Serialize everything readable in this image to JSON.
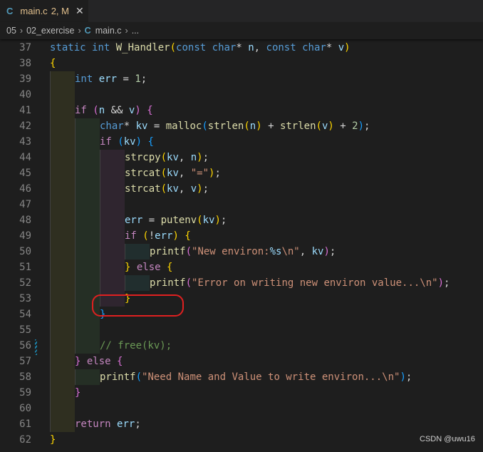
{
  "tab": {
    "icon": "C",
    "name": "main.c",
    "badge": "2, M",
    "close": "✕"
  },
  "breadcrumb": {
    "parts": [
      "05",
      "02_exercise",
      "main.c",
      "..."
    ],
    "sep": "›",
    "icon": "C"
  },
  "watermark": "CSDN @uwu16",
  "lines": [
    {
      "n": "37",
      "indent": 0,
      "tokens": [
        [
          "kw",
          "static"
        ],
        [
          "pl",
          " "
        ],
        [
          "kw",
          "int"
        ],
        [
          "pl",
          " "
        ],
        [
          "fn",
          "W_Handler"
        ],
        [
          "b1",
          "("
        ],
        [
          "kw",
          "const"
        ],
        [
          "pl",
          " "
        ],
        [
          "kw",
          "char"
        ],
        [
          "pl",
          "* "
        ],
        [
          "vr",
          "n"
        ],
        [
          "pl",
          ", "
        ],
        [
          "kw",
          "const"
        ],
        [
          "pl",
          " "
        ],
        [
          "kw",
          "char"
        ],
        [
          "pl",
          "* "
        ],
        [
          "vr",
          "v"
        ],
        [
          "b1",
          ")"
        ]
      ]
    },
    {
      "n": "38",
      "indent": 0,
      "tokens": [
        [
          "b1",
          "{"
        ]
      ]
    },
    {
      "n": "39",
      "indent": 1,
      "tokens": [
        [
          "kw",
          "int"
        ],
        [
          "pl",
          " "
        ],
        [
          "vr",
          "err"
        ],
        [
          "pl",
          " = "
        ],
        [
          "nu",
          "1"
        ],
        [
          "pl",
          ";"
        ]
      ]
    },
    {
      "n": "40",
      "indent": 0,
      "tokens": []
    },
    {
      "n": "41",
      "indent": 1,
      "tokens": [
        [
          "ct",
          "if"
        ],
        [
          "pl",
          " "
        ],
        [
          "b2",
          "("
        ],
        [
          "vr",
          "n"
        ],
        [
          "pl",
          " && "
        ],
        [
          "vr",
          "v"
        ],
        [
          "b2",
          ")"
        ],
        [
          "pl",
          " "
        ],
        [
          "b2",
          "{"
        ]
      ]
    },
    {
      "n": "42",
      "indent": 2,
      "tokens": [
        [
          "kw",
          "char"
        ],
        [
          "pl",
          "* "
        ],
        [
          "vr",
          "kv"
        ],
        [
          "pl",
          " = "
        ],
        [
          "fn",
          "malloc"
        ],
        [
          "b3",
          "("
        ],
        [
          "fn",
          "strlen"
        ],
        [
          "b1",
          "("
        ],
        [
          "vr",
          "n"
        ],
        [
          "b1",
          ")"
        ],
        [
          "pl",
          " + "
        ],
        [
          "fn",
          "strlen"
        ],
        [
          "b1",
          "("
        ],
        [
          "vr",
          "v"
        ],
        [
          "b1",
          ")"
        ],
        [
          "pl",
          " + "
        ],
        [
          "nu",
          "2"
        ],
        [
          "b3",
          ")"
        ],
        [
          "pl",
          ";"
        ]
      ]
    },
    {
      "n": "43",
      "indent": 2,
      "tokens": [
        [
          "ct",
          "if"
        ],
        [
          "pl",
          " "
        ],
        [
          "b3",
          "("
        ],
        [
          "vr",
          "kv"
        ],
        [
          "b3",
          ")"
        ],
        [
          "pl",
          " "
        ],
        [
          "b3",
          "{"
        ]
      ]
    },
    {
      "n": "44",
      "indent": 3,
      "tokens": [
        [
          "fn",
          "strcpy"
        ],
        [
          "b1",
          "("
        ],
        [
          "vr",
          "kv"
        ],
        [
          "pl",
          ", "
        ],
        [
          "vr",
          "n"
        ],
        [
          "b1",
          ")"
        ],
        [
          "pl",
          ";"
        ]
      ]
    },
    {
      "n": "45",
      "indent": 3,
      "tokens": [
        [
          "fn",
          "strcat"
        ],
        [
          "b1",
          "("
        ],
        [
          "vr",
          "kv"
        ],
        [
          "pl",
          ", "
        ],
        [
          "st",
          "\"=\""
        ],
        [
          "b1",
          ")"
        ],
        [
          "pl",
          ";"
        ]
      ]
    },
    {
      "n": "46",
      "indent": 3,
      "tokens": [
        [
          "fn",
          "strcat"
        ],
        [
          "b1",
          "("
        ],
        [
          "vr",
          "kv"
        ],
        [
          "pl",
          ", "
        ],
        [
          "vr",
          "v"
        ],
        [
          "b1",
          ")"
        ],
        [
          "pl",
          ";"
        ]
      ]
    },
    {
      "n": "47",
      "indent": 0,
      "tokens": []
    },
    {
      "n": "48",
      "indent": 3,
      "tokens": [
        [
          "vr",
          "err"
        ],
        [
          "pl",
          " = "
        ],
        [
          "fn",
          "putenv"
        ],
        [
          "b1",
          "("
        ],
        [
          "vr",
          "kv"
        ],
        [
          "b1",
          ")"
        ],
        [
          "pl",
          ";"
        ]
      ]
    },
    {
      "n": "49",
      "indent": 3,
      "tokens": [
        [
          "ct",
          "if"
        ],
        [
          "pl",
          " "
        ],
        [
          "b1",
          "("
        ],
        [
          "pl",
          "!"
        ],
        [
          "vr",
          "err"
        ],
        [
          "b1",
          ")"
        ],
        [
          "pl",
          " "
        ],
        [
          "b1",
          "{"
        ]
      ]
    },
    {
      "n": "50",
      "indent": 4,
      "tokens": [
        [
          "fn",
          "printf"
        ],
        [
          "b2",
          "("
        ],
        [
          "st",
          "\"New environ:"
        ],
        [
          "vr",
          "%s"
        ],
        [
          "st",
          "\\n\""
        ],
        [
          "pl",
          ", "
        ],
        [
          "vr",
          "kv"
        ],
        [
          "b2",
          ")"
        ],
        [
          "pl",
          ";"
        ]
      ]
    },
    {
      "n": "51",
      "indent": 3,
      "tokens": [
        [
          "b1",
          "}"
        ],
        [
          "pl",
          " "
        ],
        [
          "ct",
          "else"
        ],
        [
          "pl",
          " "
        ],
        [
          "b1",
          "{"
        ]
      ]
    },
    {
      "n": "52",
      "indent": 4,
      "tokens": [
        [
          "fn",
          "printf"
        ],
        [
          "b2",
          "("
        ],
        [
          "st",
          "\"Error on writing new environ value...\\n\""
        ],
        [
          "b2",
          ")"
        ],
        [
          "pl",
          ";"
        ]
      ]
    },
    {
      "n": "53",
      "indent": 3,
      "tokens": [
        [
          "b1",
          "}"
        ]
      ]
    },
    {
      "n": "54",
      "indent": 2,
      "tokens": [
        [
          "b3",
          "}"
        ]
      ]
    },
    {
      "n": "55",
      "indent": 0,
      "tokens": []
    },
    {
      "n": "56",
      "indent": 2,
      "tokens": [
        [
          "cm",
          "// free(kv);"
        ]
      ]
    },
    {
      "n": "57",
      "indent": 1,
      "tokens": [
        [
          "b2",
          "}"
        ],
        [
          "pl",
          " "
        ],
        [
          "ct",
          "else"
        ],
        [
          "pl",
          " "
        ],
        [
          "b2",
          "{"
        ]
      ]
    },
    {
      "n": "58",
      "indent": 2,
      "tokens": [
        [
          "fn",
          "printf"
        ],
        [
          "b3",
          "("
        ],
        [
          "st",
          "\"Need Name and Value to write environ...\\n\""
        ],
        [
          "b3",
          ")"
        ],
        [
          "pl",
          ";"
        ]
      ]
    },
    {
      "n": "59",
      "indent": 1,
      "tokens": [
        [
          "b2",
          "}"
        ]
      ]
    },
    {
      "n": "60",
      "indent": 0,
      "tokens": []
    },
    {
      "n": "61",
      "indent": 1,
      "tokens": [
        [
          "ct",
          "return"
        ],
        [
          "pl",
          " "
        ],
        [
          "vr",
          "err"
        ],
        [
          "pl",
          ";"
        ]
      ]
    },
    {
      "n": "62",
      "indent": 0,
      "tokens": [
        [
          "b1",
          "}"
        ]
      ]
    }
  ]
}
